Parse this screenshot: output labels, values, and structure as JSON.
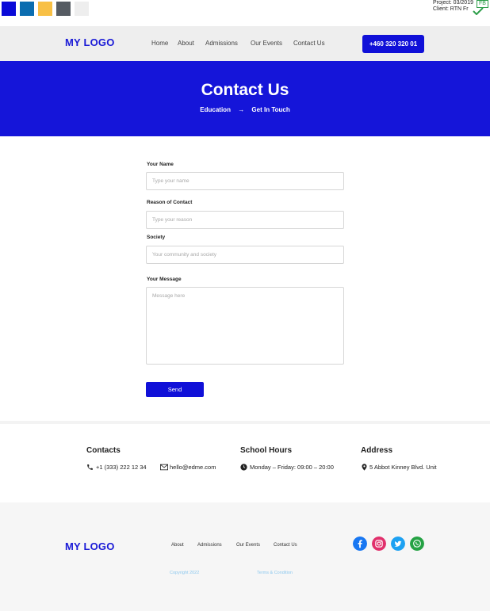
{
  "swatches": {
    "c1": "#0a0ad8",
    "c2": "#0b6db0",
    "c3": "#f8c045",
    "c4": "#565c63",
    "c5": "#eeeeee"
  },
  "project": {
    "line1": "Project: 03/2019",
    "line2": "Client: RTN Fr",
    "badge": "FB"
  },
  "header": {
    "logo": "MY LOGO",
    "nav": [
      "Home",
      "About",
      "Admissions",
      "Our Events",
      "Contact Us"
    ],
    "phone": "+460 320 320 01"
  },
  "hero": {
    "title": "Contact Us",
    "crumb1": "Education",
    "arrow": "→",
    "crumb2": "Get In Touch"
  },
  "form": {
    "name_label": "Your Name",
    "name_placeholder": "Type your name",
    "reason_label": "Reason of Contact",
    "reason_placeholder": "Type your reason",
    "society_label": "Society",
    "society_placeholder": "Your community and society",
    "message_label": "Your Message",
    "message_placeholder": "Message here",
    "send": "Send"
  },
  "info": {
    "contacts_title": "Contacts",
    "phone": "+1 (333) 222 12 34",
    "email": "hello@edme.com",
    "hours_title": "School Hours",
    "hours": "Monday – Friday: 09:00 – 20:00",
    "address_title": "Address",
    "address": "5 Abbot Kinney Blvd. Unit"
  },
  "footer": {
    "logo": "MY LOGO",
    "nav": [
      "About",
      "Admissions",
      "Our Events",
      "Contact Us"
    ],
    "copyright": "Copyright 2022",
    "terms": "Terms & Condition",
    "colors": {
      "facebook": "#1877f2",
      "instagram": "#e1306c",
      "twitter": "#1da1f2",
      "whatsapp": "#25a244"
    }
  }
}
